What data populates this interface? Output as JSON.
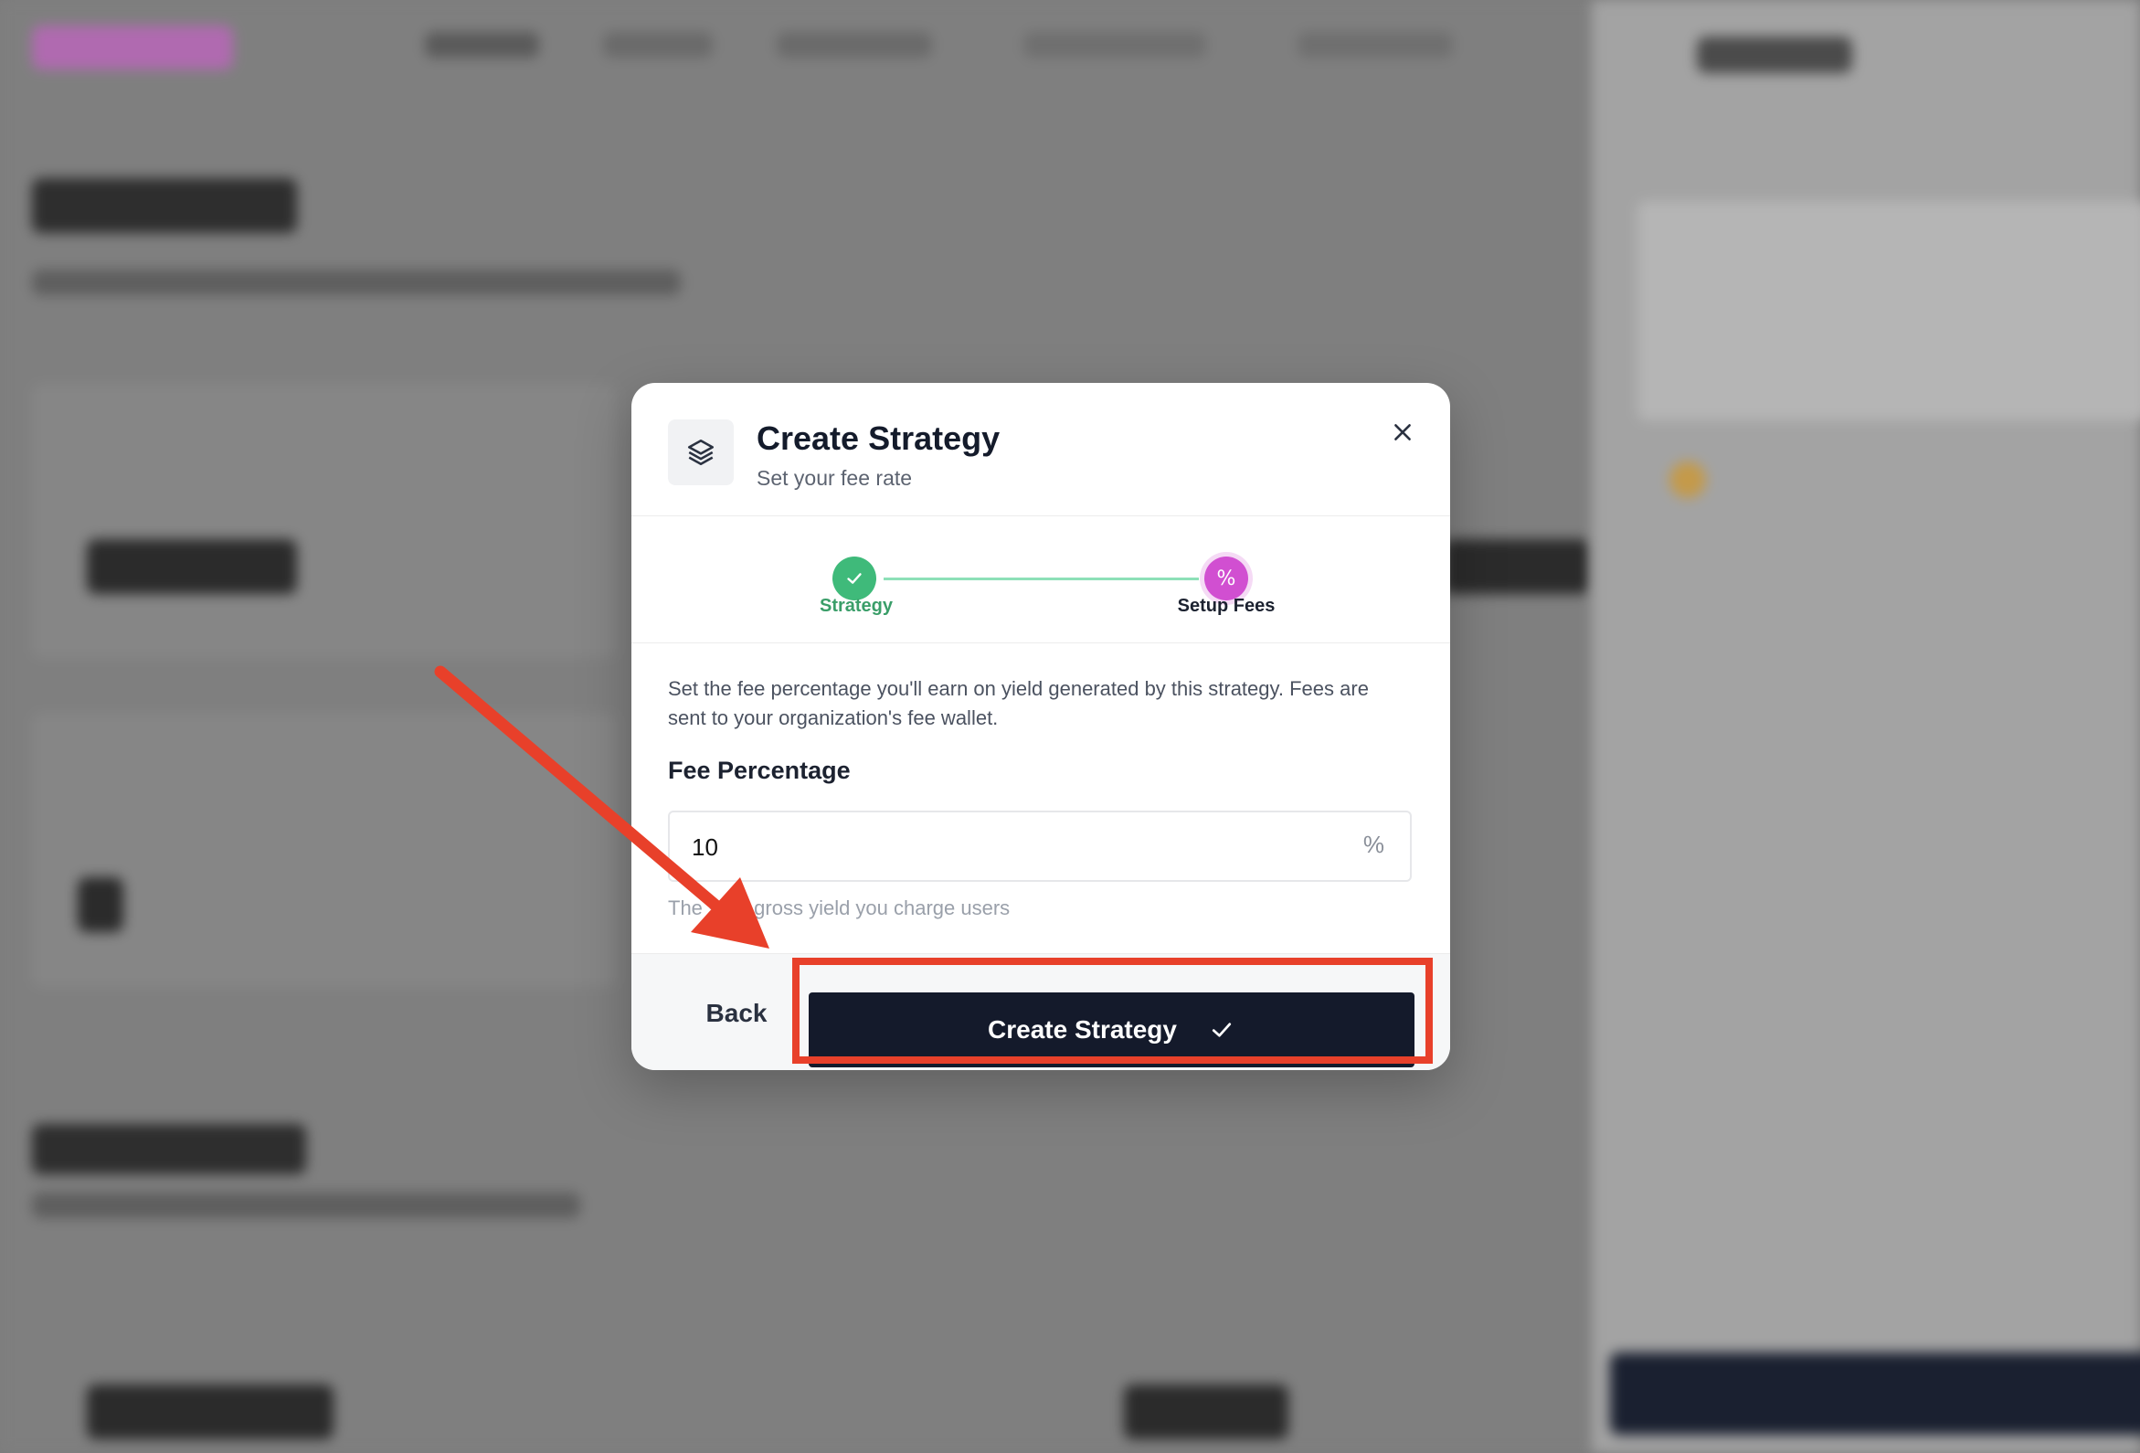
{
  "modal": {
    "title": "Create Strategy",
    "subtitle": "Set your fee rate",
    "header_icon": "layers-icon",
    "close_icon": "close-icon"
  },
  "stepper": {
    "steps": [
      {
        "label": "Strategy",
        "state": "completed",
        "icon": "check-icon"
      },
      {
        "label": "Setup Fees",
        "state": "active",
        "icon": "percent-icon",
        "glyph": "%"
      }
    ]
  },
  "form": {
    "description": "Set the fee percentage you'll earn on yield generated by this strategy. Fees are sent to your organization's fee wallet.",
    "fee_label": "Fee Percentage",
    "fee_value": "10",
    "fee_suffix": "%",
    "hint": "The % of gross yield you charge users"
  },
  "footer": {
    "back_label": "Back",
    "create_label": "Create Strategy",
    "create_icon": "check-icon"
  },
  "colors": {
    "primary_dark": "#141a2b",
    "step_complete": "#3fba7a",
    "step_active": "#d14fd1",
    "annotation_red": "#e8402a"
  }
}
